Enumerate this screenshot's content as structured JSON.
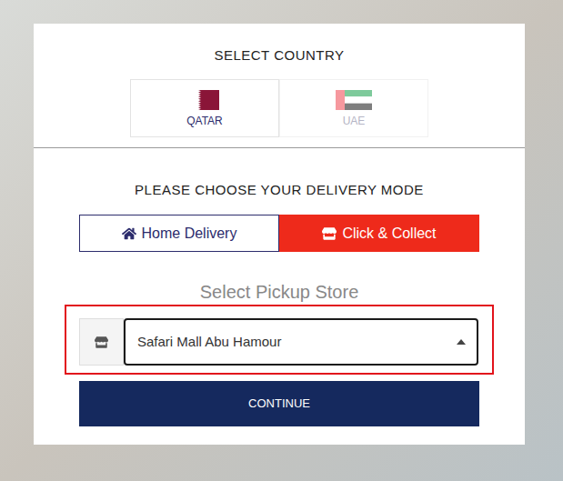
{
  "country_section": {
    "title": "SELECT COUNTRY",
    "countries": [
      {
        "name": "QATAR",
        "selected": true,
        "kind": "qatar"
      },
      {
        "name": "UAE",
        "selected": false,
        "kind": "uae"
      }
    ]
  },
  "delivery_section": {
    "title": "PLEASE CHOOSE YOUR DELIVERY MODE",
    "modes": [
      {
        "label": "Home Delivery",
        "selected": false,
        "kind": "home"
      },
      {
        "label": "Click & Collect",
        "selected": true,
        "kind": "collect"
      }
    ]
  },
  "pickup_section": {
    "title": "Select Pickup Store",
    "store": {
      "value": "Safari Mall Abu Hamour"
    }
  },
  "buttons": [
    "CONTINUE"
  ]
}
